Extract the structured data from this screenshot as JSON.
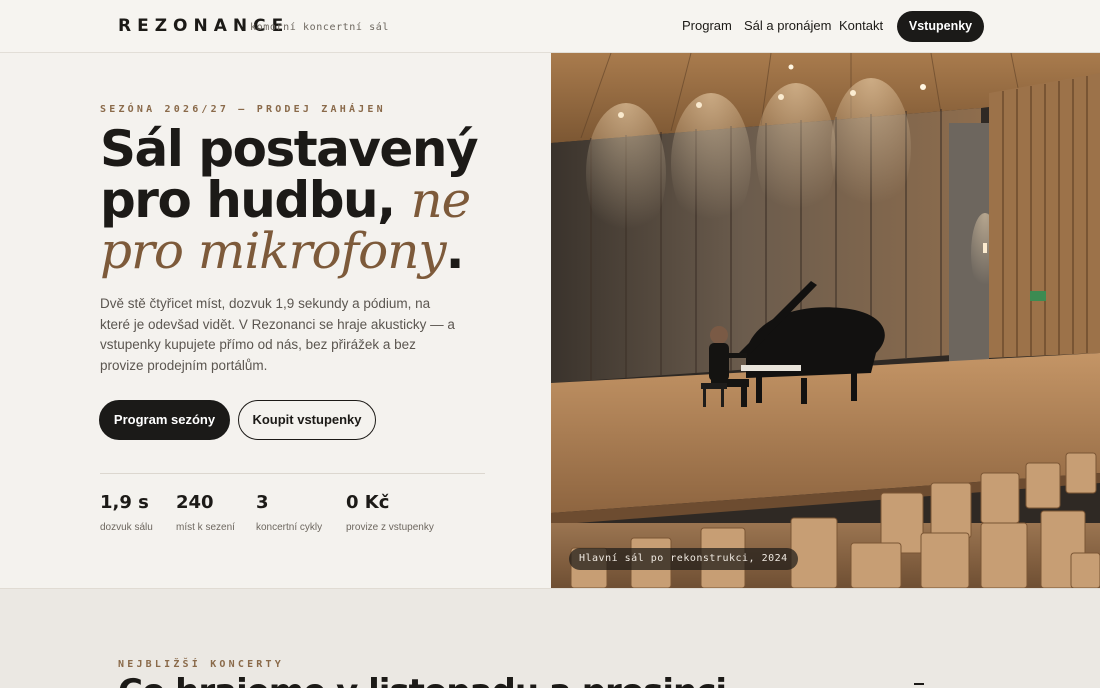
{
  "header": {
    "logo": "REZONANCE",
    "tagline": "komorní koncertní sál",
    "nav": [
      "Program",
      "Sál a pronájem",
      "Kontakt"
    ],
    "cta": "Vstupenky"
  },
  "hero": {
    "eyebrow": "SEZÓNA 2026/27 — PRODEJ ZAHÁJEN",
    "headline_part1": "Sál postavený pro hudbu, ",
    "headline_emphasis": "ne pro mikrofony",
    "headline_end": ".",
    "lede": "Dvě stě čtyřicet míst, dozvuk 1,9 sekundy a pódium, na které je odevšad vidět. V Rezonanci se hraje akusticky — a vstupenky kupujete přímo od nás, bez přirážek a bez provize prodejním portálům.",
    "buttons": {
      "primary": "Program sezóny",
      "secondary": "Koupit vstupenky"
    },
    "stats": [
      {
        "value": "1,9 s",
        "label": "dozvuk sálu"
      },
      {
        "value": "240",
        "label": "míst k sezení"
      },
      {
        "value": "3",
        "label": "koncertní cykly"
      },
      {
        "value": "0 Kč",
        "label": "provize z vstupenky"
      }
    ],
    "image_caption": "Hlavní sál po rekonstrukci, 2024"
  },
  "upcoming": {
    "eyebrow": "NEJBLIŽŠÍ KONCERTY",
    "title": "Co hrajeme v listopadu a prosinci"
  },
  "colors": {
    "accent": "#8a6a4a",
    "dark": "#1b1a18",
    "background": "#f4f2ee"
  }
}
